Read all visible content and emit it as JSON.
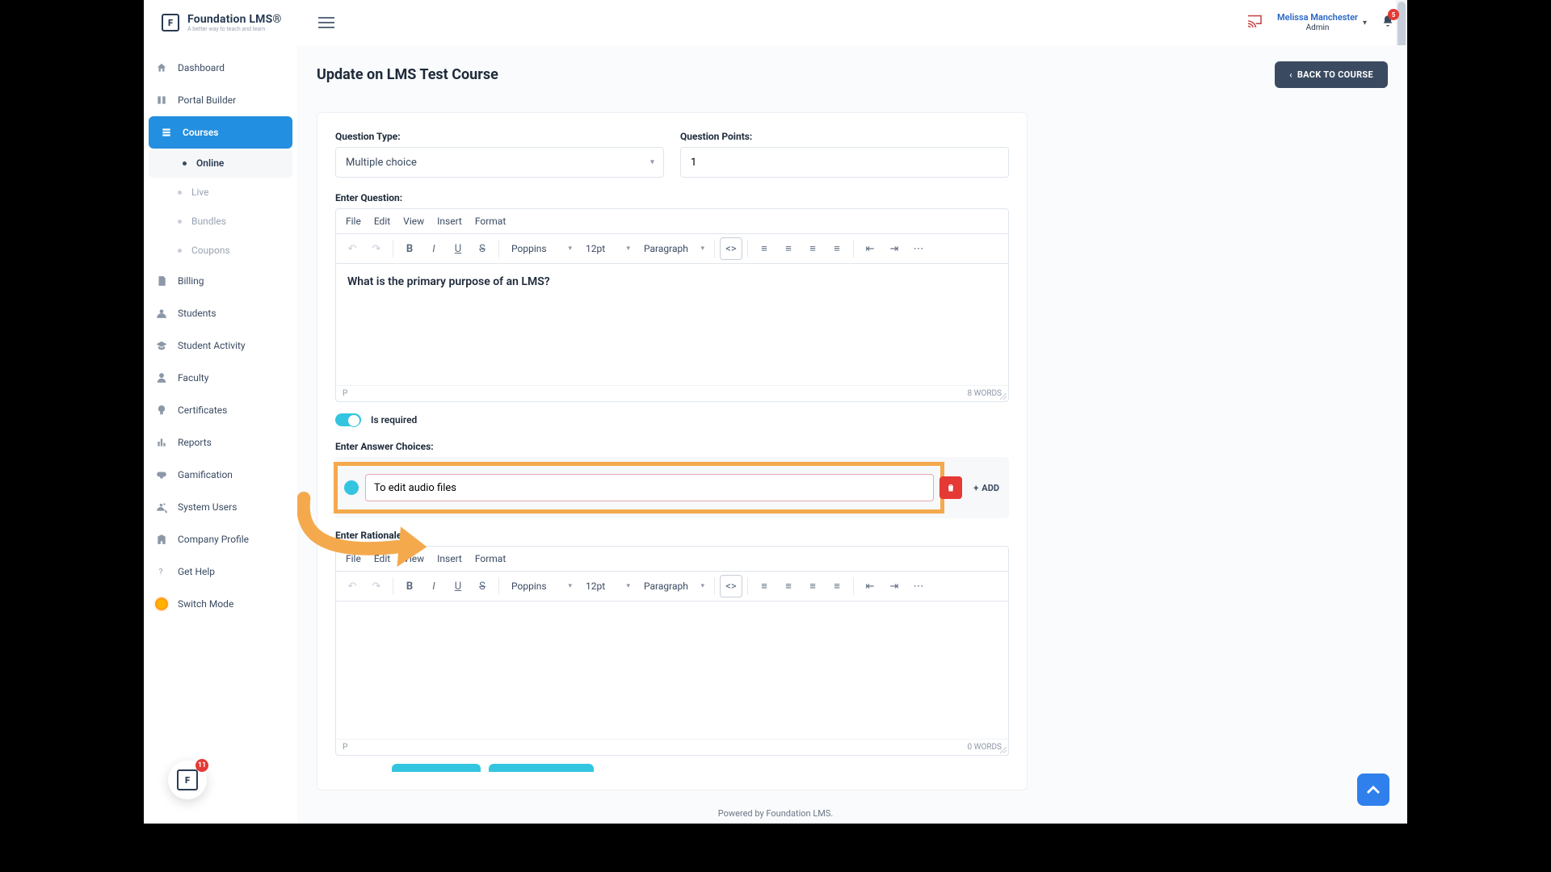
{
  "brand": {
    "name": "Foundation LMS®",
    "tagline": "A better way to teach and learn"
  },
  "user": {
    "name": "Melissa Manchester",
    "role": "Admin"
  },
  "notifications": {
    "count": "5"
  },
  "float_badge": "11",
  "page": {
    "title": "Update on LMS Test Course",
    "back_button": "BACK TO COURSE"
  },
  "sidebar": {
    "items": [
      {
        "label": "Dashboard",
        "icon": "home"
      },
      {
        "label": "Portal Builder",
        "icon": "portal"
      },
      {
        "label": "Courses",
        "icon": "courses",
        "active": true
      },
      {
        "label": "Billing",
        "icon": "billing"
      },
      {
        "label": "Students",
        "icon": "students"
      },
      {
        "label": "Student Activity",
        "icon": "cap"
      },
      {
        "label": "Faculty",
        "icon": "user"
      },
      {
        "label": "Certificates",
        "icon": "cert"
      },
      {
        "label": "Reports",
        "icon": "reports"
      },
      {
        "label": "Gamification",
        "icon": "game"
      },
      {
        "label": "System Users",
        "icon": "sysusers"
      },
      {
        "label": "Company Profile",
        "icon": "company"
      },
      {
        "label": "Get Help",
        "icon": "help"
      },
      {
        "label": "Switch Mode",
        "icon": "sun"
      }
    ],
    "sub": [
      {
        "label": "Online",
        "active": true
      },
      {
        "label": "Live"
      },
      {
        "label": "Bundles"
      },
      {
        "label": "Coupons"
      }
    ]
  },
  "form": {
    "question_type_label": "Question Type:",
    "question_type_value": "Multiple choice",
    "question_points_label": "Question Points:",
    "question_points_value": "1",
    "enter_question_label": "Enter Question:",
    "question_text": "What is the primary purpose of an LMS?",
    "word_count_q": "8 WORDS",
    "p_indicator": "P",
    "is_required_label": "Is required",
    "answer_choices_label": "Enter Answer Choices:",
    "answer_value": "To edit audio files",
    "add_label": "ADD",
    "rationale_label": "Enter Rationale:",
    "word_count_r": "0 WORDS"
  },
  "editor": {
    "menus": [
      "File",
      "Edit",
      "View",
      "Insert",
      "Format"
    ],
    "font": "Poppins",
    "size": "12pt",
    "block": "Paragraph"
  },
  "footer": "Powered by Foundation LMS."
}
